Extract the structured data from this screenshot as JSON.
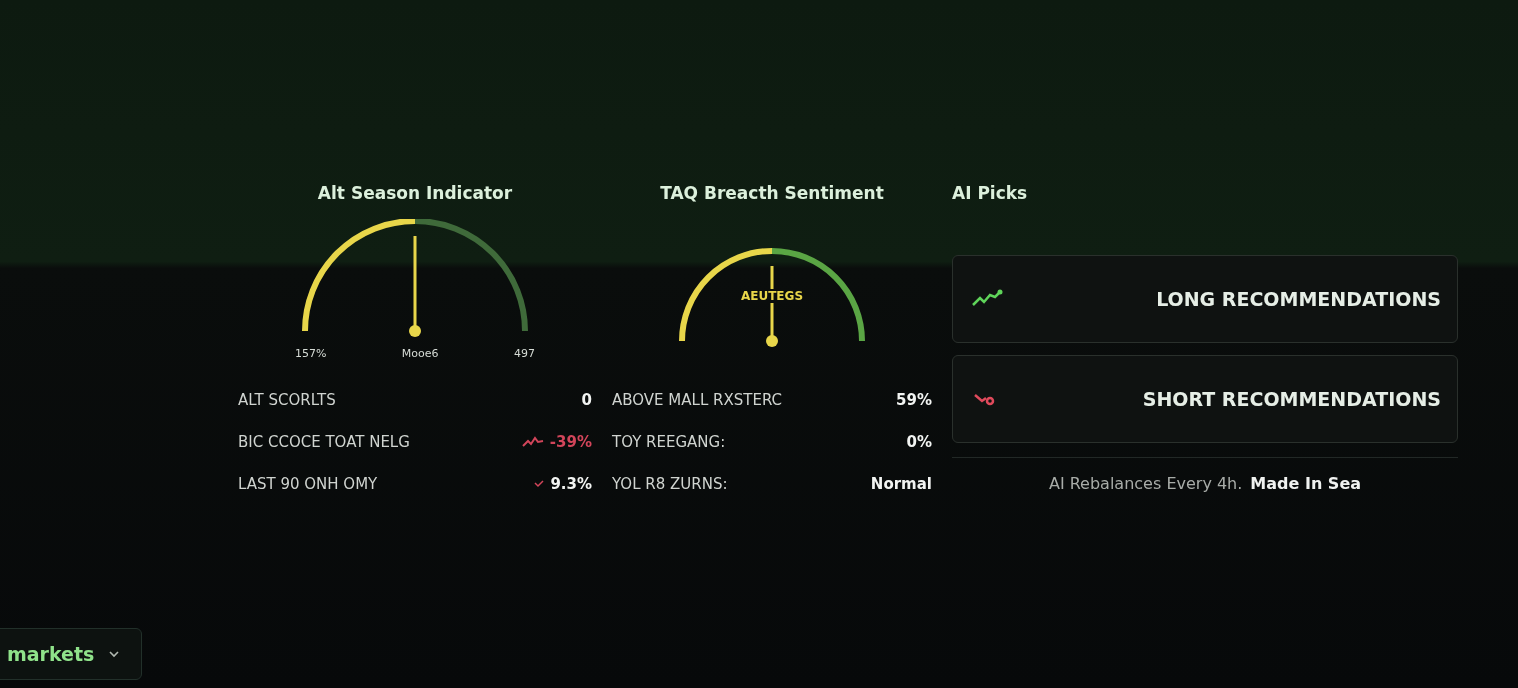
{
  "panels": [
    {
      "title": "Alt Season Indicator",
      "gauge": {
        "labels": [
          "157%",
          "Mooe6",
          "497"
        ]
      },
      "stats": [
        {
          "label": "ALT SCORLTS",
          "value": "0",
          "kind": "plain"
        },
        {
          "label": "BIC CCOCE TOAT NELG",
          "value": "-39%",
          "kind": "falling"
        },
        {
          "label": "LAST 90 ONH OMY",
          "value": "9.3%",
          "kind": "checked"
        }
      ]
    },
    {
      "title": "TAQ Breacth Sentiment",
      "gauge": {
        "center_label": "AEUTEGS"
      },
      "stats": [
        {
          "label": "ABOVE MALL RXSTERC",
          "value": "59%",
          "kind": "plain"
        },
        {
          "label": "TOY REEGANG:",
          "value": "0%",
          "kind": "plain"
        },
        {
          "label": "YOL R8 ZURNS:",
          "value": "Normal",
          "kind": "plain"
        }
      ]
    }
  ],
  "picks": {
    "title": "AI Picks",
    "buttons": [
      {
        "label": "LONG RECOMMENDATIONS",
        "kind": "long"
      },
      {
        "label": "SHORT RECOMMENDATIONS",
        "kind": "short"
      }
    ],
    "footer_note": "AI Rebalances Every 4h.",
    "footer_brand": "Made In Sea"
  },
  "market_select": {
    "value": "markets"
  }
}
